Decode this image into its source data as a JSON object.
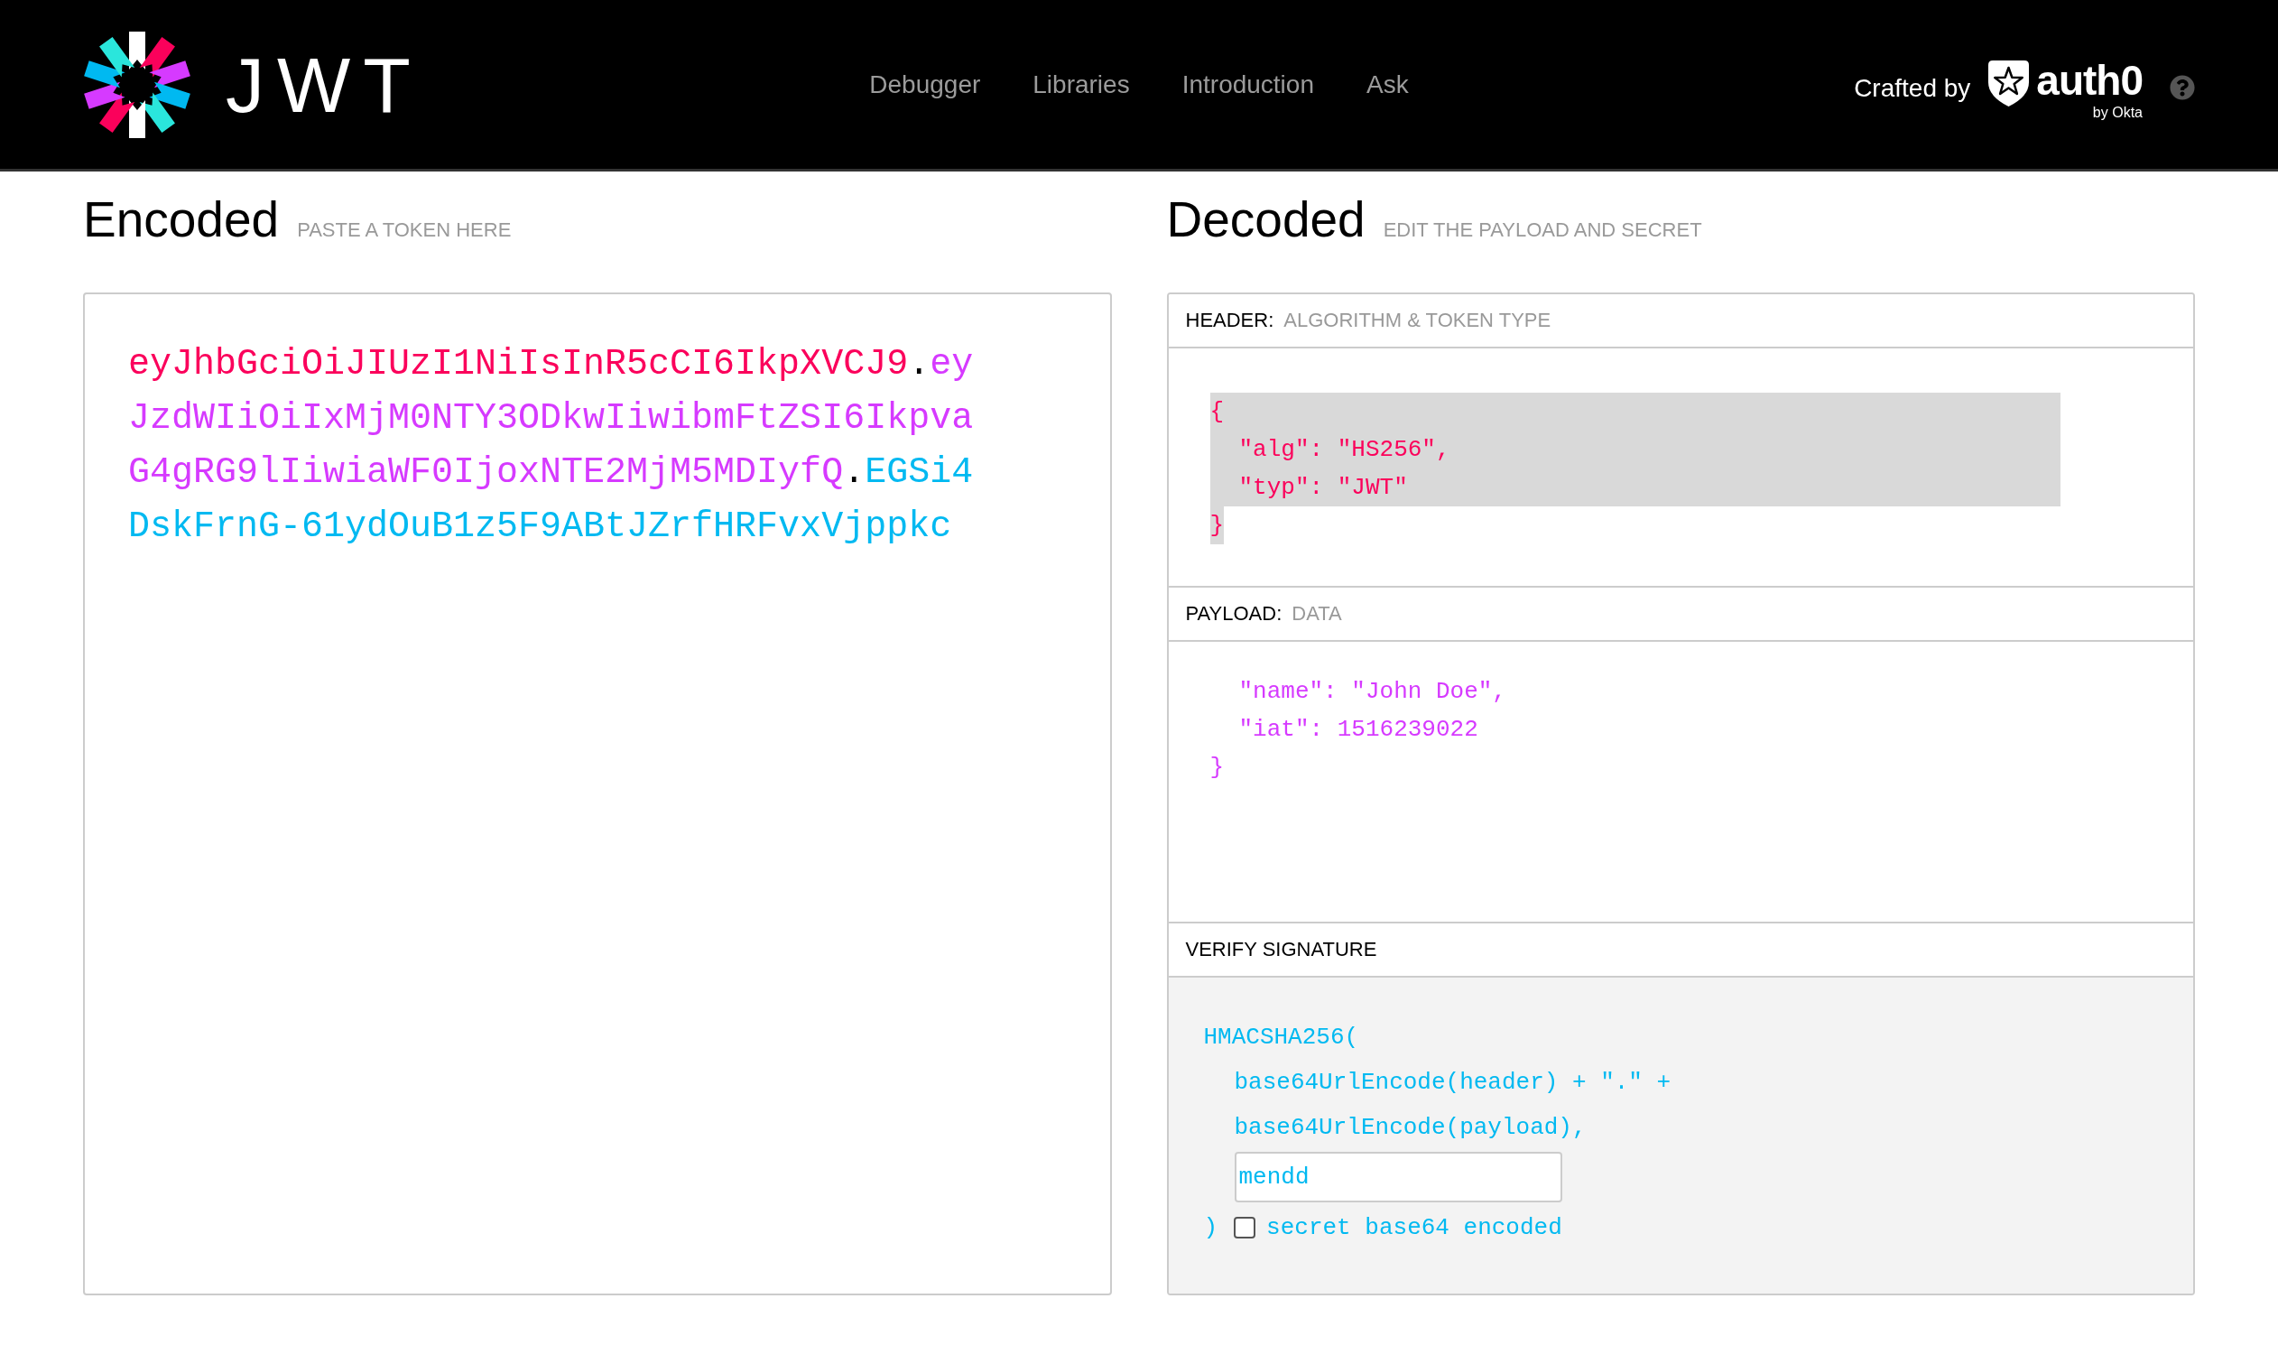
{
  "navbar": {
    "logo": {
      "text": "JWT"
    },
    "links": [
      "Debugger",
      "Libraries",
      "Introduction",
      "Ask"
    ],
    "credit": {
      "label": "Crafted by",
      "brand": "auth0",
      "tagline": "by Okta"
    }
  },
  "encoded": {
    "title": "Encoded",
    "subtitle": "PASTE A TOKEN HERE",
    "segments": [
      {
        "text": "eyJhbGciOiJIUzI1NiIsInR5cCI6IkpXVCJ9",
        "color": "#fb015b"
      },
      {
        "text": ".",
        "color": "#000000"
      },
      {
        "text": "eyJzdWIiOiIxMjM0NTY3ODkwIiwibmFtZSI6IkpvaG4gRG9lIiwiaWF0IjoxNTE2MjM5MDIyfQ",
        "color": "#d63aff"
      },
      {
        "text": ".",
        "color": "#000000"
      },
      {
        "text": "EGSi4DskFrnG-61ydOuB1z5F9ABtJZrfHRFvxVjppkc",
        "color": "#00b9f1"
      }
    ]
  },
  "decoded": {
    "title": "Decoded",
    "subtitle": "EDIT THE PAYLOAD AND SECRET",
    "sections": [
      {
        "kind": "json",
        "label": "HEADER:",
        "hint": "ALGORITHM & TOKEN TYPE",
        "color": "#fb015b",
        "code": {
          "open": {
            "text": "{",
            "selected": true
          },
          "members": [
            {
              "text": "\"alg\": \"HS256\",",
              "selected": true
            },
            {
              "text": "\"typ\": \"JWT\"",
              "selected": true
            }
          ],
          "close": {
            "text": "}",
            "selected": true
          }
        }
      },
      {
        "kind": "json",
        "label": "PAYLOAD:",
        "hint": "DATA",
        "color": "#d63aff",
        "code": {
          "members": [
            {
              "text": "\"name\": \"John Doe\",",
              "selected": false
            },
            {
              "text": "\"iat\": 1516239022",
              "selected": false
            }
          ],
          "close": {
            "text": "}",
            "selected": false
          }
        }
      },
      {
        "kind": "signature",
        "label": "VERIFY SIGNATURE",
        "color": "#00b9f1",
        "function": "HMACSHA256(",
        "args": [
          "base64UrlEncode(header) + \".\" +",
          "base64UrlEncode(payload),"
        ],
        "secret": {
          "value": "mendd"
        },
        "close": ")",
        "option": {
          "label": "secret base64 encoded",
          "checked": false
        }
      }
    ]
  }
}
